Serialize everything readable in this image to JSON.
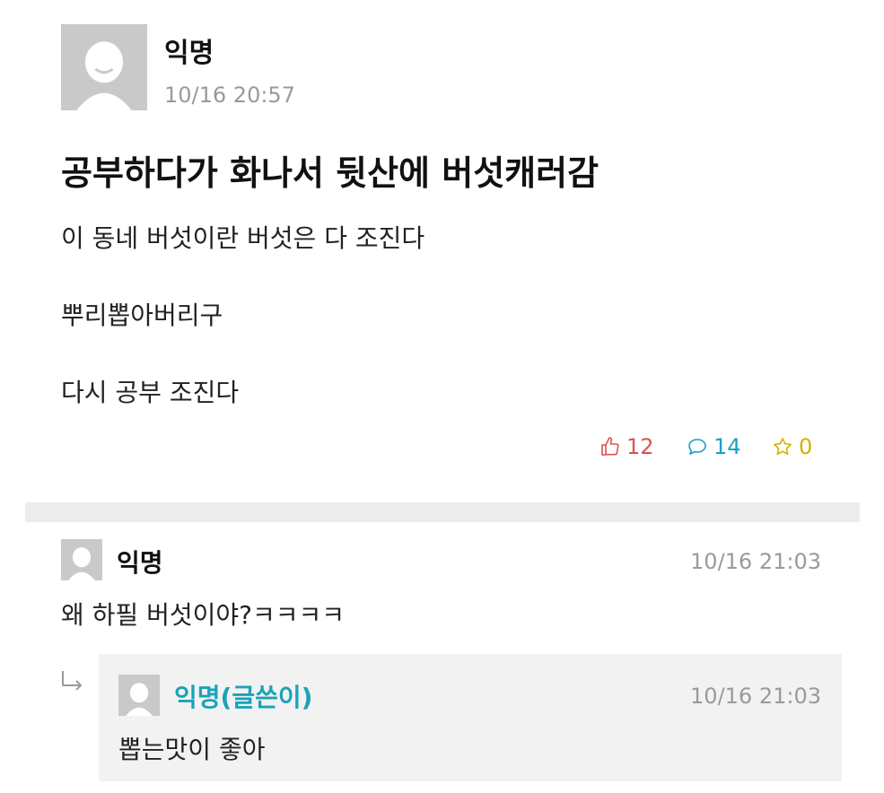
{
  "post": {
    "author": "익명",
    "time": "10/16 20:57",
    "title": "공부하다가 화나서 뒷산에 버섯캐러감",
    "body": [
      "이 동네 버섯이란 버섯은 다 조진다",
      "뿌리뽑아버리구",
      "다시 공부 조진다"
    ],
    "stats": {
      "likes": "12",
      "comments": "14",
      "scraps": "0"
    },
    "stat_colors": {
      "likes": "#d9534f",
      "comments": "#1a9fc6",
      "scraps": "#d4b000"
    }
  },
  "comments": [
    {
      "author": "익명",
      "time": "10/16 21:03",
      "text": "왜 하필 버섯이야?ㅋㅋㅋㅋ",
      "avatar_icon": "default-avatar-icon"
    },
    {
      "author": "익명(글쓴이)",
      "time": "10/16 21:03",
      "text": "뽑는맛이 좋아",
      "is_reply": true,
      "author_color": "#1aa3b8",
      "avatar_icon": "default-avatar-icon"
    }
  ],
  "icons": {
    "like": "thumbs-up-icon",
    "comment": "speech-bubble-icon",
    "scrap": "star-icon",
    "reply": "reply-arrow-icon"
  }
}
